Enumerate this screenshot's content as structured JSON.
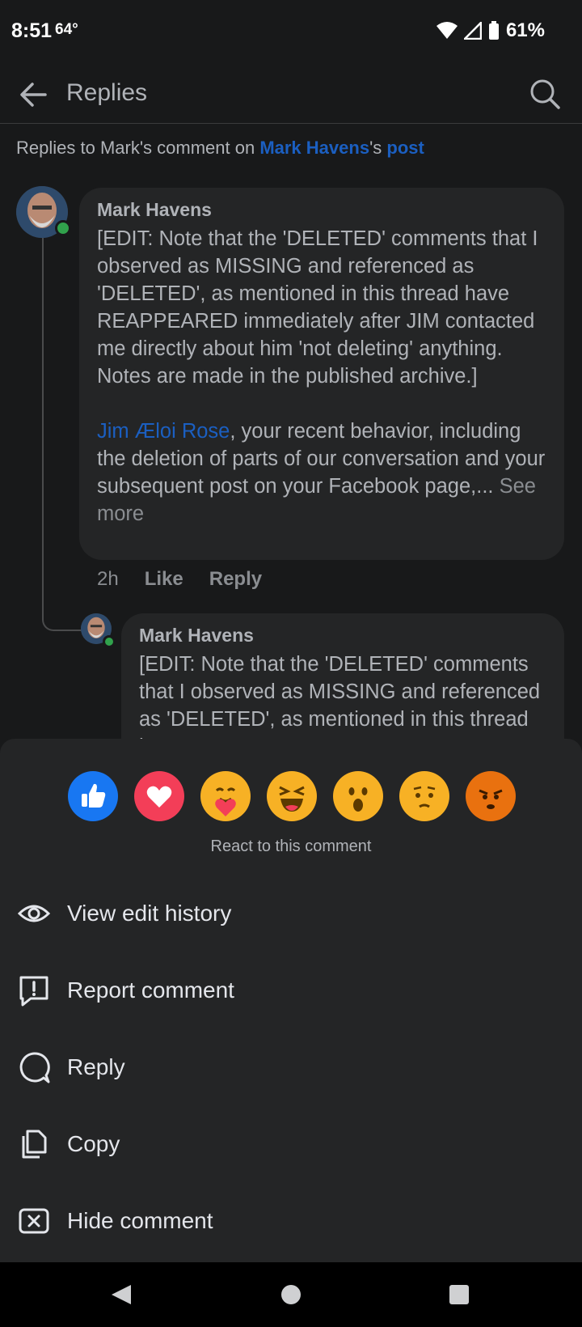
{
  "status": {
    "time": "8:51",
    "temp": "64°",
    "battery": "61%"
  },
  "header": {
    "title": "Replies"
  },
  "context": {
    "prefix": "Replies to Mark's comment on ",
    "author_link": "Mark Havens",
    "possessive": "'s ",
    "post_link": "post"
  },
  "comment1": {
    "author": "Mark Havens",
    "edit_note": "[EDIT: Note that the 'DELETED' comments that I observed as MISSING and referenced as 'DELETED', as mentioned in this thread have REAPPEARED immediately after JIM contacted me directly about him 'not deleting' anything. Notes are made in the published archive.]",
    "mention": "Jim Æloi Rose",
    "body": ", your recent behavior, including the deletion of parts of our conversation and your subsequent post on your Facebook page,...",
    "see_more": " See more",
    "time": "2h",
    "like": "Like",
    "reply": "Reply"
  },
  "comment2": {
    "author": "Mark Havens",
    "text": "[EDIT: Note that the 'DELETED' comments that I observed as MISSING and referenced as 'DELETED', as mentioned in this thread have REAPPEARED"
  },
  "sheet": {
    "reactions": [
      "like-reaction",
      "love-reaction",
      "care-reaction",
      "haha-reaction",
      "wow-reaction",
      "sad-reaction",
      "angry-reaction"
    ],
    "react_label": "React to this comment",
    "menu": [
      {
        "label": "View edit history",
        "icon": "eye-icon"
      },
      {
        "label": "Report comment",
        "icon": "report-icon"
      },
      {
        "label": "Reply",
        "icon": "reply-icon"
      },
      {
        "label": "Copy",
        "icon": "copy-icon"
      },
      {
        "label": "Hide comment",
        "icon": "hide-icon"
      }
    ]
  },
  "colors": {
    "background": "#18191a",
    "sheet": "#242526",
    "link": "#1b5fc1",
    "online": "#31a24c"
  }
}
